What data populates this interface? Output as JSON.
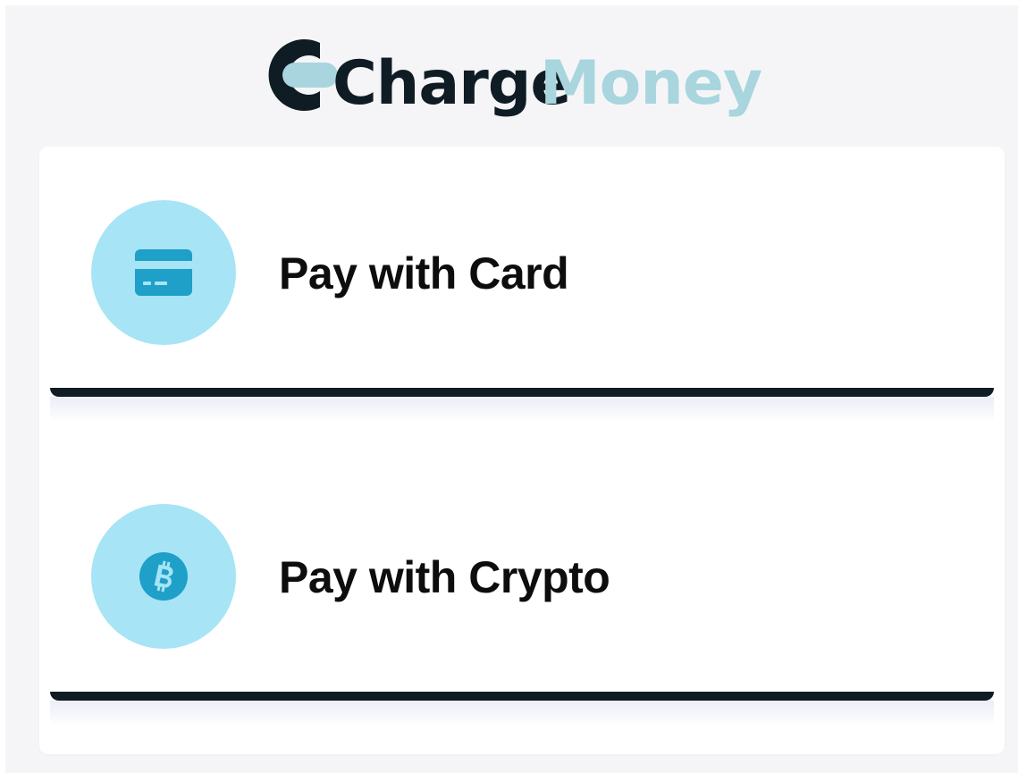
{
  "brand": {
    "logo_part1": "Charge",
    "logo_part2": "Money",
    "logo_color_dark": "#0f1c24",
    "logo_color_light": "#a8d5de"
  },
  "payment_options": [
    {
      "label": "Pay with Card",
      "icon": "credit-card-icon"
    },
    {
      "label": "Pay with Crypto",
      "icon": "bitcoin-icon"
    }
  ],
  "colors": {
    "icon_circle": "#a7e4f5",
    "icon_fill": "#1ea0c8",
    "bar": "#0f1c24",
    "background": "#f5f5f7"
  }
}
